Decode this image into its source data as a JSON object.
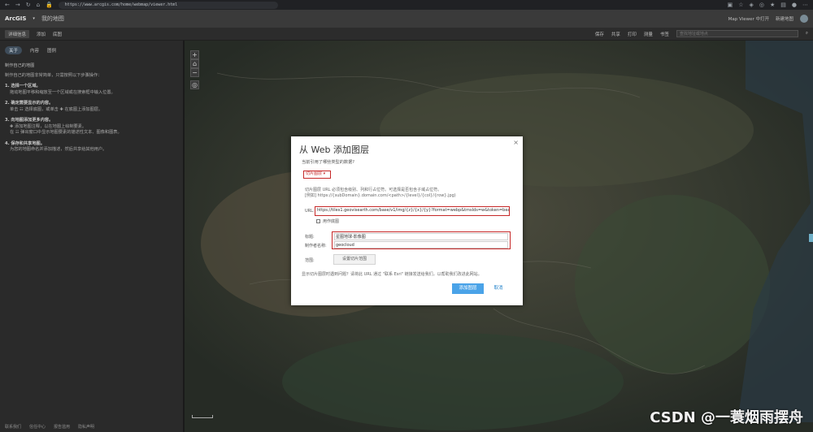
{
  "browser": {
    "url": "https://www.arcgis.com/home/webmap/viewer.html"
  },
  "header": {
    "logo": "ArcGIS",
    "map_title": "我的地图",
    "map_viewer_link": "Map Viewer 中打开",
    "new_map": "新建地图"
  },
  "toolbar": {
    "details": "详细信息",
    "add": "添加",
    "basemap": "底图",
    "save": "保存",
    "share": "共享",
    "print": "打印",
    "measure": "测量",
    "bookmarks": "书签",
    "search_placeholder": "查找地址或地点"
  },
  "side_panel": {
    "tabs": [
      "关于",
      "内容",
      "图例"
    ],
    "heading": "制作自己的地图",
    "intro": "制作自己的地图非常简单，只需按照以下步骤操作：",
    "steps": [
      {
        "title": "1. 选择一个区域。",
        "text": "拖动地图平移和缩放至一个区域或在搜索框中输入位置。"
      },
      {
        "title": "2. 确定需要显示的内容。",
        "text": "单击 ☷ 选择底图，或单击 ✚ 在底图上添加图层。"
      },
      {
        "title": "3. 向地图添加更多内容。",
        "text": "✚ 添加地图注释，以在地图上绘制要素。"
      },
      {
        "title": "",
        "text": "在 ☷ 弹出窗口中显示地图要素的描述性文本、图像和图表。"
      },
      {
        "title": "4. 保存和共享地图。",
        "text": "为您的地图命名并添加描述，然后共享给其他用户。"
      }
    ],
    "footer": [
      "联系我们",
      "信任中心",
      "报告滥用",
      "隐私声明"
    ]
  },
  "dialog": {
    "title": "从 Web 添加图层",
    "question": "当前引用了哪些类型的数据?",
    "type_value": "切片图层",
    "desc_line1": "切片图层 URL 必须包含级别、列和行占位符。可选择是否包含子域占位符。",
    "desc_line2": "[例如] https://{subDomain}.domain.com/<path>/{level}/{col}/{row}.jpg)",
    "url_label": "URL:",
    "url_value": "https://tiles1.geovisearth.com/base/v1/img/{z}/{x}/{y}?format=webp&tmsIds=w&token=bea60e",
    "basemap_checkbox": "用作底图",
    "title_label": "标题:",
    "title_value": "星图地球-影像图",
    "credits_label": "制作者名称:",
    "credits_value": "geocloud",
    "extent_label": "范围:",
    "extent_button": "设置切片范围",
    "help_text": "显示切片图层时遇到问题？请将此 URL 通过 \"联系 Esri\" 链接发送给我们，以帮助我们改进此网站。",
    "add_button": "添加图层",
    "cancel_button": "取消",
    "close": "×"
  },
  "map": {
    "zoom_in": "+",
    "zoom_out": "−",
    "home": "⌂"
  },
  "watermark": "CSDN @一蓑烟雨摆舟"
}
